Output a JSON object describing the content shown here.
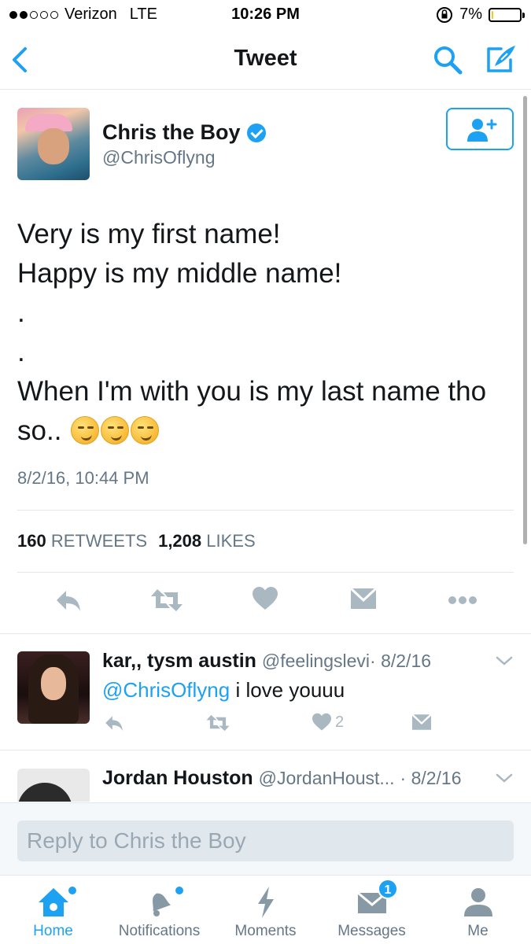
{
  "status_bar": {
    "carrier": "Verizon",
    "network": "LTE",
    "time": "10:26 PM",
    "battery_percent": "7%",
    "battery_level": 0.07
  },
  "nav": {
    "title": "Tweet",
    "back_icon": "chevron-left-icon",
    "search_icon": "search-icon",
    "compose_icon": "compose-icon"
  },
  "tweet": {
    "author_name": "Chris the Boy",
    "author_handle": "@ChrisOflyng",
    "verified": true,
    "lines": [
      "Very is my first name!",
      "Happy is my middle name!",
      ".",
      ".",
      "When I'm with you is my last name tho",
      "so.. "
    ],
    "emoji": [
      "smirk-emoji",
      "smirk-emoji",
      "smirk-emoji"
    ],
    "timestamp": "8/2/16, 10:44 PM",
    "retweets_count": "160",
    "retweets_label": "RETWEETS",
    "likes_count": "1,208",
    "likes_label": "LIKES",
    "actions": [
      "reply-icon",
      "retweet-icon",
      "like-icon",
      "direct-message-icon",
      "more-icon"
    ]
  },
  "replies": [
    {
      "name": "kar,, tysm austin",
      "handle": "@feelingslevi",
      "date": "· 8/2/16",
      "mention": "@ChrisOflyng",
      "text": " i love youuu",
      "likes": "2"
    },
    {
      "name": "Jordan Houston",
      "handle": "@JordanHoust...",
      "date": "· 8/2/16"
    }
  ],
  "reply_bar": {
    "placeholder": "Reply to Chris the Boy"
  },
  "tabs": [
    {
      "label": "Home",
      "icon": "home-icon",
      "active": true
    },
    {
      "label": "Notifications",
      "icon": "bell-icon",
      "active": false
    },
    {
      "label": "Moments",
      "icon": "lightning-icon",
      "active": false
    },
    {
      "label": "Messages",
      "icon": "envelope-icon",
      "active": false,
      "badge": "1"
    },
    {
      "label": "Me",
      "icon": "person-icon",
      "active": false
    }
  ],
  "colors": {
    "accent": "#1da1f2",
    "text": "#14171a",
    "muted": "#657786",
    "divider": "#e1e8ed"
  }
}
